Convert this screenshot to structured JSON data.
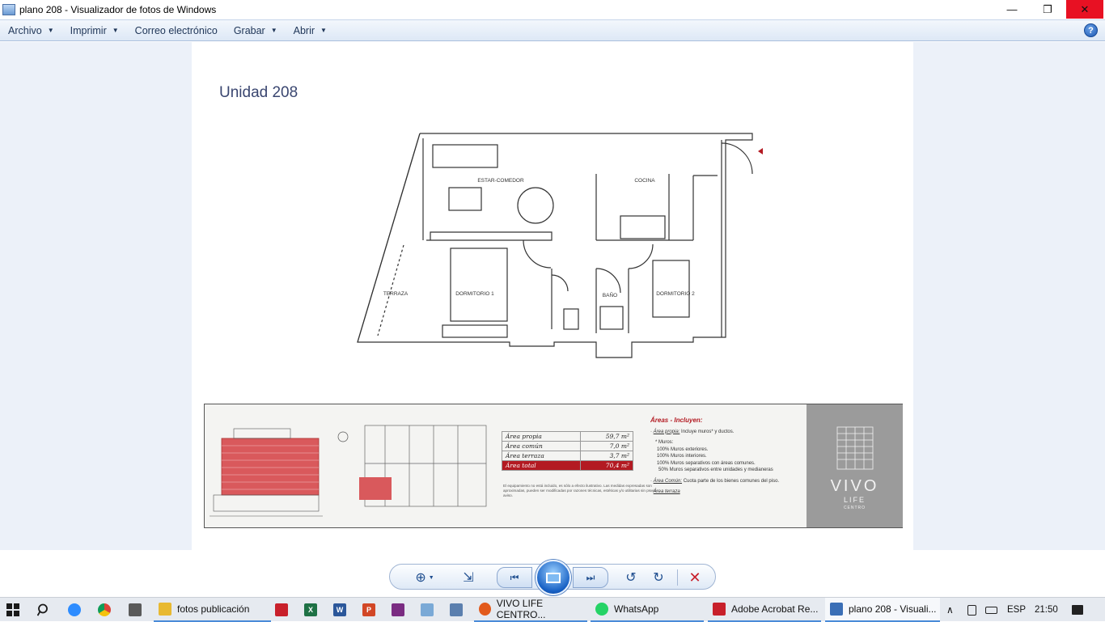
{
  "window": {
    "title": "plano 208 - Visualizador de fotos de Windows",
    "minimize_glyph": "—",
    "maximize_glyph": "❐",
    "close_glyph": "✕"
  },
  "menu": {
    "items": [
      {
        "label": "Archivo",
        "dropdown": true
      },
      {
        "label": "Imprimir",
        "dropdown": true
      },
      {
        "label": "Correo electrónico",
        "dropdown": false
      },
      {
        "label": "Grabar",
        "dropdown": true
      },
      {
        "label": "Abrir",
        "dropdown": true
      }
    ],
    "help_glyph": "?"
  },
  "image": {
    "unit_title": "Unidad 208",
    "rooms": {
      "estar": "ESTAR-COMEDOR",
      "cocina": "COCINA",
      "dorm1": "DORMITORIO 1",
      "dorm2": "DORMITORIO 2",
      "bano": "BAÑO",
      "terraza": "TERRAZA"
    },
    "table": [
      {
        "label": "Área propia",
        "value": "59,7 m²"
      },
      {
        "label": "Área común",
        "value": "7,0 m²"
      },
      {
        "label": "Área terraza",
        "value": "3,7 m²"
      },
      {
        "label": "Área total",
        "value": "70,4 m²"
      }
    ],
    "note": "El equipamiento no está incluido, es sólo a efecto ilustrativo. Las medidas expresadas son aproximadas, pueden ser modificadas por razones técnicas, estéticas y/o utilitarias sin previo aviso.",
    "areas": {
      "heading": "Áreas - Incluyen:",
      "propia_label": "Área propia:",
      "propia_text": "Incluye muros* y ductos.",
      "muros_title": "* Muros:",
      "muros_lines": [
        "100% Muros exteriores.",
        "100% Muros interiores.",
        "100% Muros separativos con áreas comunes.",
        "50% Muros separativos entre unidades y medianeras"
      ],
      "comun_label": "Área Común:",
      "comun_text": "Cuota parte de los bienes comunes del piso.",
      "terraza_label": "Área terraza"
    },
    "brand": {
      "name": "VIVO",
      "sub": "LIFE",
      "sub2": "CENTRO"
    },
    "accent": "#b31a22"
  },
  "toolbar": {
    "zoom_glyph": "⊕",
    "fit_glyph": "⇲",
    "prev_glyph": "⏮",
    "next_glyph": "⏭",
    "rotate_left_glyph": "↺",
    "rotate_right_glyph": "↻",
    "delete_glyph": "✕"
  },
  "taskbar": {
    "tasks": [
      {
        "label": "fotos publicación",
        "icon": "folder-icon",
        "color": "#e8b931"
      },
      {
        "label": "VIVO LIFE CENTRO...",
        "icon": "firefox-icon",
        "color": "#e25a1c"
      },
      {
        "label": "WhatsApp",
        "icon": "whatsapp-icon",
        "color": "#25d366"
      },
      {
        "label": "Adobe Acrobat Re...",
        "icon": "acrobat-icon",
        "color": "#c8202b"
      },
      {
        "label": "plano 208 - Visuali...",
        "icon": "photo-viewer-icon",
        "color": "#3b6fb6"
      }
    ],
    "lang": "ESP",
    "time": "21:50"
  }
}
